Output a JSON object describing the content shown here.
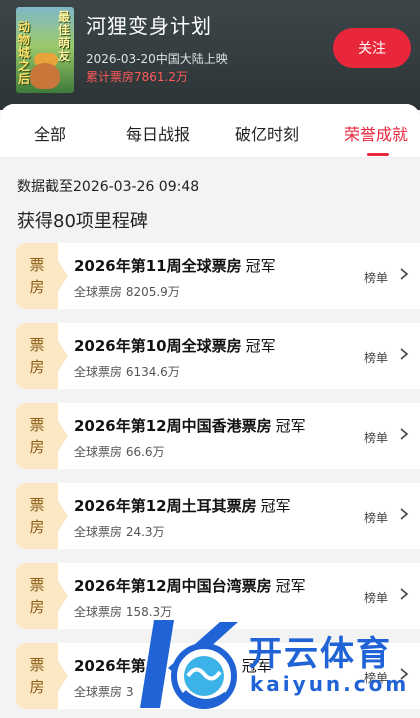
{
  "movie": {
    "title": "河狸变身计划",
    "release": "2026-03-20中国大陆上映",
    "boxoffice": "累计票房7861.2万",
    "follow_label": "关注",
    "poster_text_left": "动物城之后",
    "poster_text_right": "最佳萌友"
  },
  "tabs": [
    {
      "label": "全部"
    },
    {
      "label": "每日战报"
    },
    {
      "label": "破亿时刻"
    },
    {
      "label": "荣誉成就",
      "active": true
    }
  ],
  "timestamp": "数据截至2026-03-26  09:48",
  "milestone_count": "获得80项里程碑",
  "cards": [
    {
      "badge_top": "票",
      "badge_bottom": "房",
      "title": "2026年第11周全球票房",
      "suffix": "冠军",
      "sub": "全球票房 8205.9万",
      "rank_label": "榜单"
    },
    {
      "badge_top": "票",
      "badge_bottom": "房",
      "title": "2026年第10周全球票房",
      "suffix": "冠军",
      "sub": "全球票房 6134.6万",
      "rank_label": "榜单"
    },
    {
      "badge_top": "票",
      "badge_bottom": "房",
      "title": "2026年第12周中国香港票房",
      "suffix": "冠军",
      "sub": "全球票房 66.6万",
      "rank_label": "榜单"
    },
    {
      "badge_top": "票",
      "badge_bottom": "房",
      "title": "2026年第12周土耳其票房",
      "suffix": "冠军",
      "sub": "全球票房 24.3万",
      "rank_label": "榜单"
    },
    {
      "badge_top": "票",
      "badge_bottom": "房",
      "title": "2026年第12周中国台湾票房",
      "suffix": "冠军",
      "sub": "全球票房 158.3万",
      "rank_label": "榜单"
    },
    {
      "badge_top": "票",
      "badge_bottom": "房",
      "title": "2026年第",
      "suffix": "冠军",
      "sub": "全球票房 3",
      "rank_label": "榜单"
    }
  ],
  "watermark": {
    "cn": "开云体育",
    "en": "kaiyun.com"
  },
  "colors": {
    "accent": "#e8273b",
    "badge_bg": "#fbe7c2",
    "watermark": "#1f63d6"
  }
}
